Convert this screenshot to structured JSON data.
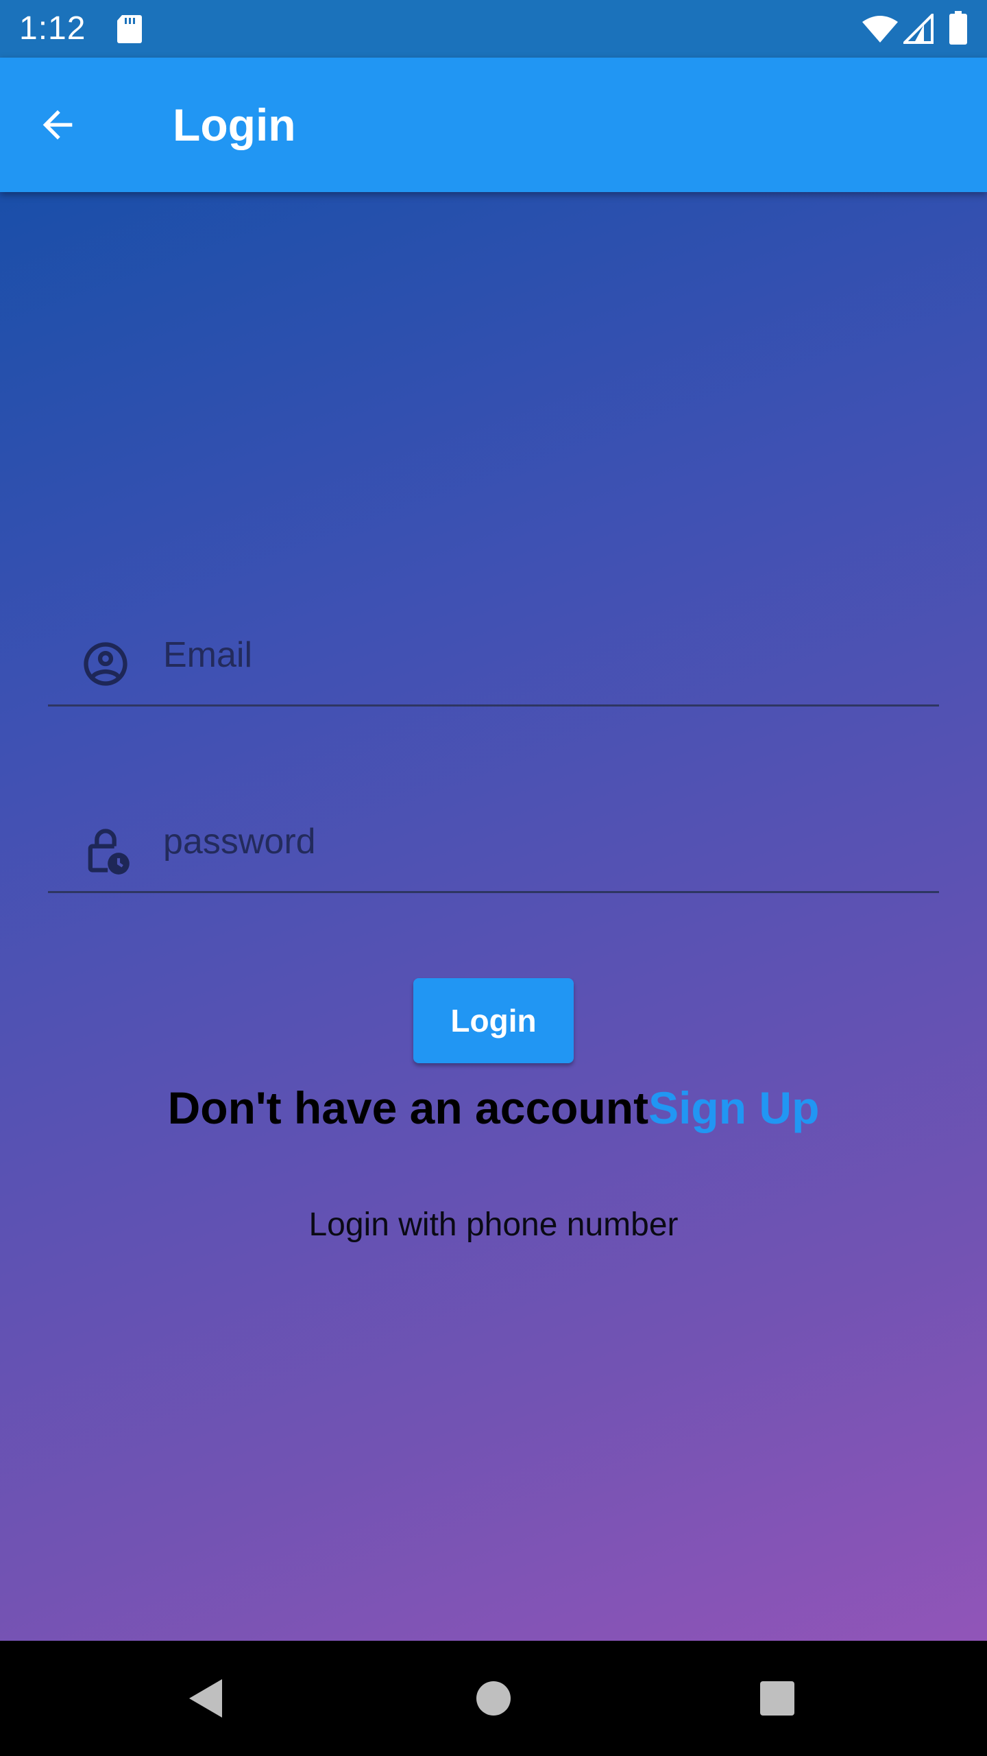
{
  "status_bar": {
    "time": "1:12",
    "icons": [
      "sd-card-icon",
      "wifi-icon",
      "cell-signal-icon",
      "battery-icon"
    ]
  },
  "app_bar": {
    "title": "Login",
    "back_icon": "arrow-back-icon",
    "color": "#2196f3"
  },
  "form": {
    "email": {
      "placeholder": "Email",
      "value": "",
      "icon": "account-circle-icon"
    },
    "password": {
      "placeholder": "password",
      "value": "",
      "icon": "lock-clock-icon"
    },
    "login_button_label": "Login"
  },
  "signup": {
    "prompt": "Don't have an account",
    "link": "Sign Up",
    "link_color": "#2196f3"
  },
  "phone_login": {
    "label": "Login with phone number"
  },
  "nav_bar": {
    "icons": [
      "back-triangle-icon",
      "home-circle-icon",
      "recents-square-icon"
    ]
  },
  "colors": {
    "gradient_start": "#1a4fa9",
    "gradient_end": "#9155b8",
    "status_bar": "#1b72bb"
  }
}
